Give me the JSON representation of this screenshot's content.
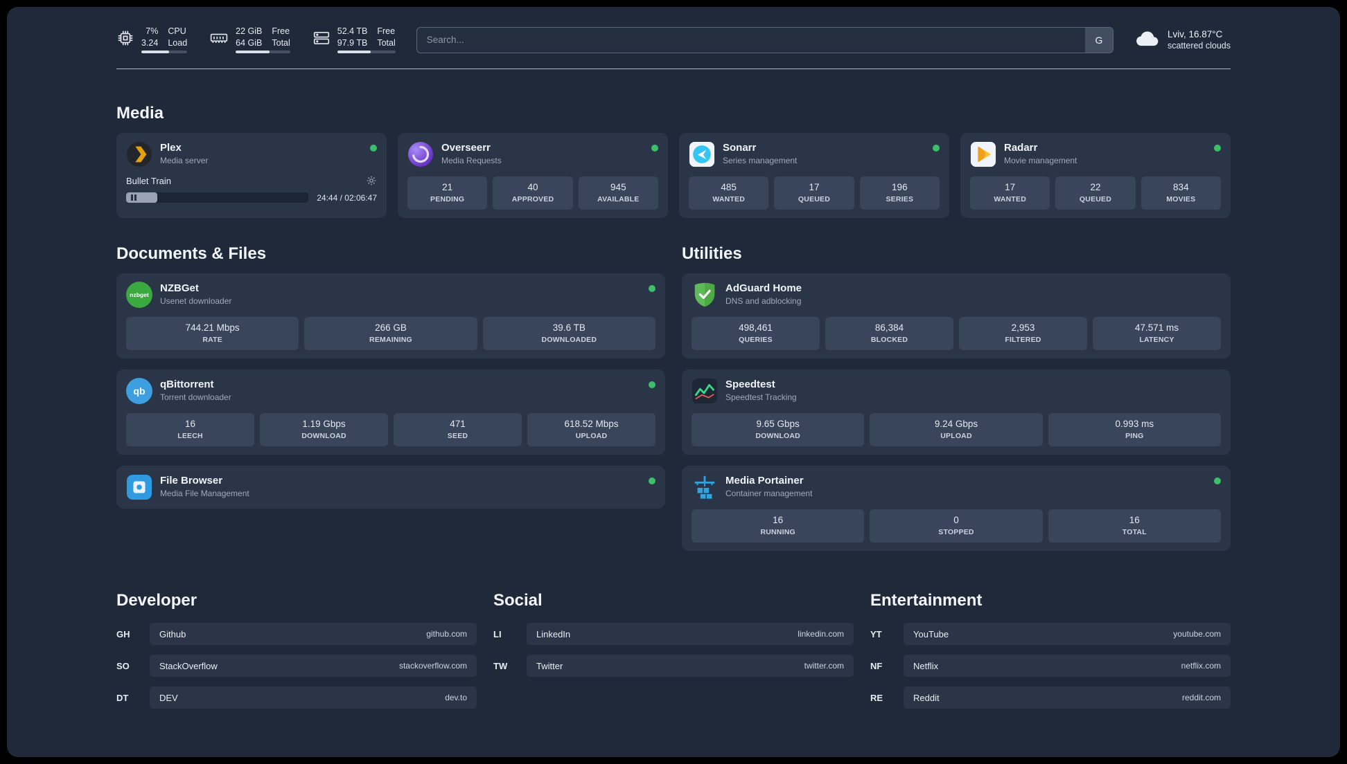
{
  "colors": {
    "status_online": "#3cbf68",
    "accent_green": "#5fbb57",
    "accent_blue": "#35c5f4",
    "accent_amber": "#e5a00d"
  },
  "header": {
    "cpu": {
      "line1": "7%",
      "line2": "3.24",
      "label1": "CPU",
      "label2": "Load",
      "bar_percent": 60
    },
    "ram": {
      "line1": "22 GiB",
      "line2": "64 GiB",
      "label1": "Free",
      "label2": "Total",
      "bar_percent": 62
    },
    "disk": {
      "line1": "52.4 TB",
      "line2": "97.9 TB",
      "label1": "Free",
      "label2": "Total",
      "bar_percent": 57
    },
    "search": {
      "placeholder": "Search...",
      "engine_label": "G"
    },
    "weather": {
      "location": "Lviv, 16.87°C",
      "condition": "scattered clouds"
    }
  },
  "media": {
    "title": "Media",
    "plex": {
      "name": "Plex",
      "subtitle": "Media server",
      "now_playing": "Bullet Train",
      "time": "24:44 / 02:06:47",
      "progress_percent": 17
    },
    "overseerr": {
      "name": "Overseerr",
      "subtitle": "Media Requests",
      "stats": [
        {
          "value": "21",
          "label": "PENDING"
        },
        {
          "value": "40",
          "label": "APPROVED"
        },
        {
          "value": "945",
          "label": "AVAILABLE"
        }
      ]
    },
    "sonarr": {
      "name": "Sonarr",
      "subtitle": "Series management",
      "stats": [
        {
          "value": "485",
          "label": "WANTED"
        },
        {
          "value": "17",
          "label": "QUEUED"
        },
        {
          "value": "196",
          "label": "SERIES"
        }
      ]
    },
    "radarr": {
      "name": "Radarr",
      "subtitle": "Movie management",
      "stats": [
        {
          "value": "17",
          "label": "WANTED"
        },
        {
          "value": "22",
          "label": "QUEUED"
        },
        {
          "value": "834",
          "label": "MOVIES"
        }
      ]
    }
  },
  "documents": {
    "title": "Documents & Files",
    "nzbget": {
      "name": "NZBGet",
      "subtitle": "Usenet downloader",
      "icon_text": "nzbget",
      "stats": [
        {
          "value": "744.21 Mbps",
          "label": "RATE"
        },
        {
          "value": "266 GB",
          "label": "REMAINING"
        },
        {
          "value": "39.6 TB",
          "label": "DOWNLOADED"
        }
      ]
    },
    "qbittorrent": {
      "name": "qBittorrent",
      "subtitle": "Torrent downloader",
      "icon_text": "qb",
      "stats": [
        {
          "value": "16",
          "label": "LEECH"
        },
        {
          "value": "1.19 Gbps",
          "label": "DOWNLOAD"
        },
        {
          "value": "471",
          "label": "SEED"
        },
        {
          "value": "618.52 Mbps",
          "label": "UPLOAD"
        }
      ]
    },
    "filebrowser": {
      "name": "File Browser",
      "subtitle": "Media File Management"
    }
  },
  "utilities": {
    "title": "Utilities",
    "adguard": {
      "name": "AdGuard Home",
      "subtitle": "DNS and adblocking",
      "stats": [
        {
          "value": "498,461",
          "label": "QUERIES"
        },
        {
          "value": "86,384",
          "label": "BLOCKED"
        },
        {
          "value": "2,953",
          "label": "FILTERED"
        },
        {
          "value": "47.571 ms",
          "label": "LATENCY"
        }
      ]
    },
    "speedtest": {
      "name": "Speedtest",
      "subtitle": "Speedtest Tracking",
      "stats": [
        {
          "value": "9.65 Gbps",
          "label": "DOWNLOAD"
        },
        {
          "value": "9.24 Gbps",
          "label": "UPLOAD"
        },
        {
          "value": "0.993 ms",
          "label": "PING"
        }
      ]
    },
    "portainer": {
      "name": "Media Portainer",
      "subtitle": "Container management",
      "stats": [
        {
          "value": "16",
          "label": "RUNNING"
        },
        {
          "value": "0",
          "label": "STOPPED"
        },
        {
          "value": "16",
          "label": "TOTAL"
        }
      ]
    }
  },
  "bookmarks": {
    "developer": {
      "title": "Developer",
      "items": [
        {
          "abbr": "GH",
          "name": "Github",
          "url": "github.com"
        },
        {
          "abbr": "SO",
          "name": "StackOverflow",
          "url": "stackoverflow.com"
        },
        {
          "abbr": "DT",
          "name": "DEV",
          "url": "dev.to"
        }
      ]
    },
    "social": {
      "title": "Social",
      "items": [
        {
          "abbr": "LI",
          "name": "LinkedIn",
          "url": "linkedin.com"
        },
        {
          "abbr": "TW",
          "name": "Twitter",
          "url": "twitter.com"
        }
      ]
    },
    "entertainment": {
      "title": "Entertainment",
      "items": [
        {
          "abbr": "YT",
          "name": "YouTube",
          "url": "youtube.com"
        },
        {
          "abbr": "NF",
          "name": "Netflix",
          "url": "netflix.com"
        },
        {
          "abbr": "RE",
          "name": "Reddit",
          "url": "reddit.com"
        }
      ]
    }
  }
}
